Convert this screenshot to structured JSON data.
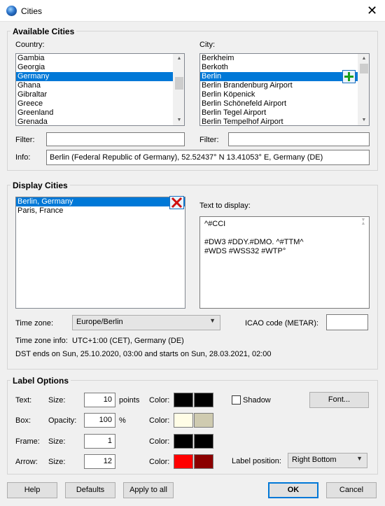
{
  "window": {
    "title": "Cities",
    "close": "✕"
  },
  "available": {
    "heading": "Available Cities",
    "country_label": "Country:",
    "city_label": "City:",
    "countries": [
      "Gambia",
      "Georgia",
      "Germany",
      "Ghana",
      "Gibraltar",
      "Greece",
      "Greenland",
      "Grenada"
    ],
    "selected_country": "Germany",
    "cities": [
      "Berkheim",
      "Berkoth",
      "Berlin",
      "Berlin Brandenburg Airport",
      "Berlin Köpenick",
      "Berlin Schönefeld Airport",
      "Berlin Tegel Airport",
      "Berlin Tempelhof Airport"
    ],
    "selected_city": "Berlin",
    "filter_label": "Filter:",
    "filter_country_value": "",
    "filter_city_value": "",
    "info_label": "Info:",
    "info_value": "Berlin (Federal Republic of Germany), 52.52437° N  13.41053° E, Germany (DE)"
  },
  "display": {
    "heading": "Display Cities",
    "cities": [
      "Berlin, Germany",
      "Paris, France"
    ],
    "selected": "Berlin, Germany",
    "text_label": "Text to display:",
    "text_lines": [
      "^#CCI",
      "",
      "#DW3 #DDY.#DMO. ^#TTM^",
      "#WDS #WSS32 #WTP°"
    ],
    "timezone_label": "Time zone:",
    "timezone_value": "Europe/Berlin",
    "icao_label": "ICAO code (METAR):",
    "icao_value": "",
    "tz_info_label": "Time zone info:",
    "tz_info_value": "UTC+1:00 (CET), Germany (DE)",
    "dst_text": "DST ends on Sun, 25.10.2020, 03:00 and starts on Sun, 28.03.2021, 02:00"
  },
  "label_options": {
    "heading": "Label Options",
    "text_row": {
      "label": "Text:",
      "field_label": "Size:",
      "value": "10",
      "unit": "points",
      "color_label": "Color:"
    },
    "box_row": {
      "label": "Box:",
      "field_label": "Opacity:",
      "value": "100",
      "unit": "%",
      "color_label": "Color:"
    },
    "frame_row": {
      "label": "Frame:",
      "field_label": "Size:",
      "value": "1",
      "color_label": "Color:"
    },
    "arrow_row": {
      "label": "Arrow:",
      "field_label": "Size:",
      "value": "12",
      "color_label": "Color:"
    },
    "shadow_label": "Shadow",
    "shadow_checked": false,
    "font_button": "Font...",
    "position_label": "Label position:",
    "position_value": "Right Bottom",
    "colors": {
      "text": [
        "#000000",
        "#000000"
      ],
      "box": [
        "#fffde6",
        "#cfcbb0"
      ],
      "frame": [
        "#000000",
        "#000000"
      ],
      "arrow": [
        "#ff0000",
        "#8b0000"
      ]
    }
  },
  "buttons": {
    "help": "Help",
    "defaults": "Defaults",
    "apply_all": "Apply to all",
    "ok": "OK",
    "cancel": "Cancel"
  },
  "icons": {
    "window_icon": "globe-icon",
    "add_city": "plus-icon",
    "remove_city": "x-icon",
    "accent": "#0078d7",
    "add_color": "#1a9e1a",
    "remove_color": "#d01010"
  }
}
